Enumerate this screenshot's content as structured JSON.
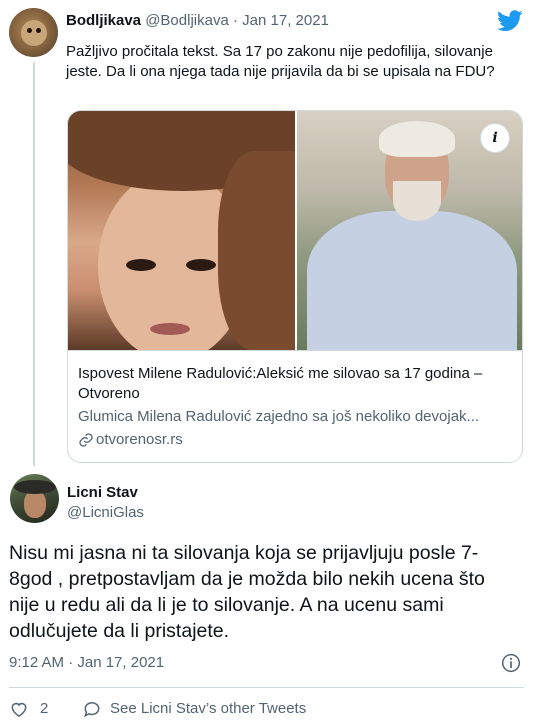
{
  "parent_tweet": {
    "name": "Bodljikava",
    "handle": "@Bodljikava",
    "separator": "·",
    "date": "Jan 17, 2021",
    "text": "Pažljivo pročitala tekst. Sa 17 po zakonu nije pedofilija, silovanje jeste. Da li ona njega tada nije prijavila da bi se upisala na FDU?",
    "card": {
      "title": "Ispovest Milene Radulović:Aleksić me silovao sa 17 godina – Otvoreno",
      "description": "Glumica Milena Radulović zajedno sa još nekoliko devojak...",
      "domain": "otvorenosr.rs",
      "info_glyph": "i"
    }
  },
  "main_tweet": {
    "name": "Licni Stav",
    "handle": "@LicniGlas",
    "text": "Nisu mi jasna ni ta silovanja koja se prijavljuju posle 7-8god , pretpostavljam da je možda bilo nekih ucena što nije u redu ali da li je to silovanje. A na ucenu sami odlučujete da li pristajete.",
    "timestamp": "9:12 AM · Jan 17, 2021",
    "like_count": "2",
    "see_more": "See Licni Stav’s other Tweets"
  },
  "colors": {
    "twitter_blue": "#1d9bf0",
    "text": "#0f1419",
    "secondary": "#536471",
    "border": "#cfd9de"
  },
  "icons": [
    "twitter-logo-icon",
    "info-icon",
    "link-icon",
    "heart-icon",
    "speech-bubble-icon"
  ]
}
